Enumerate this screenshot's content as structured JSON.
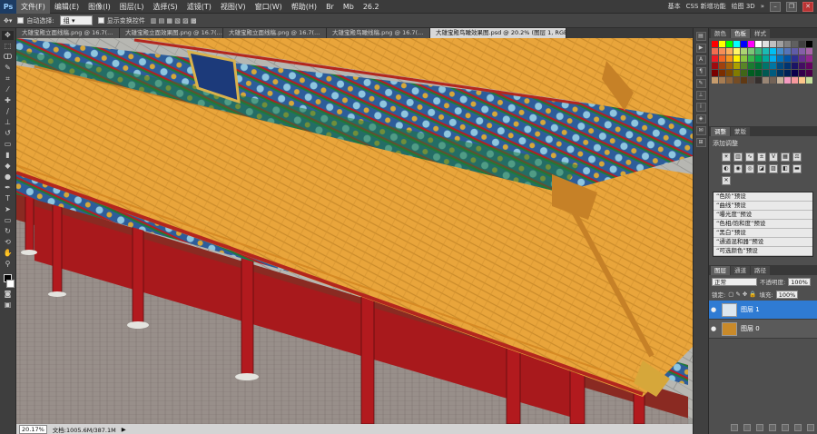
{
  "app": {
    "logo": "Ps",
    "menu": [
      "文件(F)",
      "编辑(E)",
      "图像(I)",
      "图层(L)",
      "选择(S)",
      "滤镜(T)",
      "视图(V)",
      "窗口(W)",
      "帮助(H)"
    ],
    "zoom": "26.2"
  },
  "workspace": {
    "items": [
      "基本",
      "CSS 新增功能",
      "绘图 3D"
    ]
  },
  "options": {
    "auto_select_label": "自动选择:",
    "auto_select_value": "组",
    "show_transform_label": "显示变换控件"
  },
  "tabs": [
    "大雄宝殿立面线稿.png @ 16.7(...",
    "大雄宝殿立面效果图.png @ 16.7(...",
    "大雄宝殿立面线稿.png @ 16.7(...",
    "大雄宝殿鸟瞰线稿.png @ 16.7(...",
    "大雄宝殿鸟瞰效果图.psd @ 20.2% (图层 1, RGB/8) *"
  ],
  "status": {
    "zoom": "20.17%",
    "doc": "文档:1005.6M/387.1M"
  },
  "panels": {
    "color_tabs": [
      "颜色",
      "色板",
      "样式"
    ],
    "adjust_tabs": [
      "调整",
      "蒙版"
    ],
    "adjust_title": "添加调整",
    "presets": [
      "“色阶”预设",
      "“曲线”预设",
      "“曝光度”预设",
      "“色相/饱和度”预设",
      "“黑白”预设",
      "“通道混和器”预设",
      "“可选颜色”预设"
    ],
    "layer_tabs": [
      "图层",
      "通道",
      "路径"
    ],
    "blend_mode": "正常",
    "opacity_label": "不透明度:",
    "opacity_value": "100%",
    "lock_label": "锁定:",
    "fill_label": "填充:",
    "fill_value": "100%",
    "layers": [
      {
        "name": "图层 1",
        "selected": true
      },
      {
        "name": "图层 0",
        "selected": false
      }
    ]
  },
  "colors": {
    "roof": "#e8a43a",
    "pillar": "#a8191c",
    "beam_blue": "#2d5d9a",
    "selected_layer": "#2f7bd3"
  },
  "swatch_colors": [
    "#ff0000",
    "#ffff00",
    "#00ff00",
    "#00ffff",
    "#0000ff",
    "#ff00ff",
    "#ffffff",
    "#e0e0e0",
    "#c0c0c0",
    "#a0a0a0",
    "#808080",
    "#606060",
    "#404040",
    "#000000",
    "#f26c4f",
    "#f68e56",
    "#fbaf5d",
    "#fff568",
    "#acd373",
    "#7cc576",
    "#3bb878",
    "#1abbb4",
    "#00bff3",
    "#438ccb",
    "#5574b9",
    "#605ca8",
    "#855fa8",
    "#a864a8",
    "#ed1c24",
    "#f26522",
    "#f7941d",
    "#fff200",
    "#8dc63f",
    "#39b54a",
    "#00a651",
    "#00a99d",
    "#00aeef",
    "#0072bc",
    "#0054a6",
    "#2e3192",
    "#662d91",
    "#92278f",
    "#9e0b0f",
    "#a0410d",
    "#a36209",
    "#aba000",
    "#598527",
    "#1a7b30",
    "#007236",
    "#00746b",
    "#0076a3",
    "#004a80",
    "#003471",
    "#1b1464",
    "#440e62",
    "#630460",
    "#790000",
    "#7b2e00",
    "#7d4900",
    "#827b00",
    "#406618",
    "#005e20",
    "#005826",
    "#005952",
    "#005b7f",
    "#003663",
    "#002157",
    "#0d004c",
    "#32004b",
    "#4b0049",
    "#c69c6d",
    "#a67c52",
    "#8c6239",
    "#754c24",
    "#603913",
    "#534741",
    "#362f2d",
    "#998675",
    "#736357",
    "#c7b299",
    "#f49ac1",
    "#f6989d",
    "#fdc68a",
    "#c4df9b"
  ]
}
